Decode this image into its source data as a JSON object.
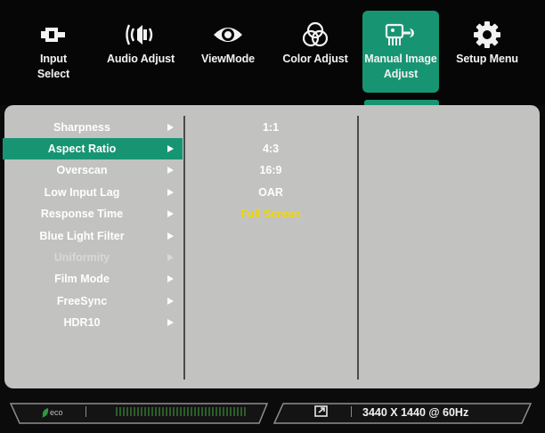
{
  "tabs": [
    {
      "label_1": "Input",
      "label_2": "Select",
      "icon": "input-select-icon"
    },
    {
      "label_1": "Audio Adjust",
      "label_2": "",
      "icon": "speaker-icon"
    },
    {
      "label_1": "ViewMode",
      "label_2": "",
      "icon": "eye-icon"
    },
    {
      "label_1": "Color Adjust",
      "label_2": "",
      "icon": "color-circles-icon"
    },
    {
      "label_1": "Manual Image",
      "label_2": "Adjust",
      "icon": "image-wrench-icon",
      "active": true
    },
    {
      "label_1": "Setup Menu",
      "label_2": "",
      "icon": "gear-icon"
    }
  ],
  "menu": {
    "items": [
      {
        "label": "Sharpness"
      },
      {
        "label": "Aspect Ratio",
        "selected": true
      },
      {
        "label": "Overscan"
      },
      {
        "label": "Low Input Lag"
      },
      {
        "label": "Response Time"
      },
      {
        "label": "Blue Light Filter"
      },
      {
        "label": "Uniformity",
        "disabled": true
      },
      {
        "label": "Film Mode"
      },
      {
        "label": "FreeSync"
      },
      {
        "label": "HDR10"
      }
    ]
  },
  "options": {
    "items": [
      "1:1",
      "4:3",
      "16:9",
      "OAR",
      "Full Screen"
    ],
    "current": "Full Screen"
  },
  "status": {
    "eco_label": "eco",
    "resolution": "3440 X 1440 @ 60Hz"
  },
  "colors": {
    "accent": "#179573",
    "panel": "#c2c2c0",
    "highlight_text": "#f0d800"
  }
}
